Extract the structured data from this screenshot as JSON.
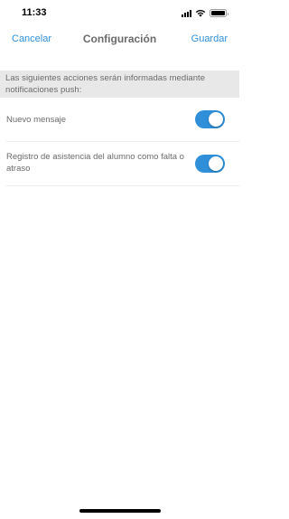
{
  "status_bar": {
    "time": "11:33",
    "icons": [
      "cellular-signal-icon",
      "wifi-icon",
      "battery-icon"
    ],
    "battery_level": 1.0
  },
  "nav": {
    "cancel_label": "Cancelar",
    "title": "Configuración",
    "save_label": "Guardar"
  },
  "section": {
    "header": "Las siguientes acciones serán informadas mediante notificaciones push:"
  },
  "settings": [
    {
      "label": "Nuevo mensaje",
      "enabled": true
    },
    {
      "label": "Registro de asistencia del alumno como falta o atraso",
      "enabled": true
    }
  ],
  "colors": {
    "accent": "#2f8fd8",
    "text_secondary": "#6b6b6b",
    "section_background": "#e8e8e8"
  }
}
